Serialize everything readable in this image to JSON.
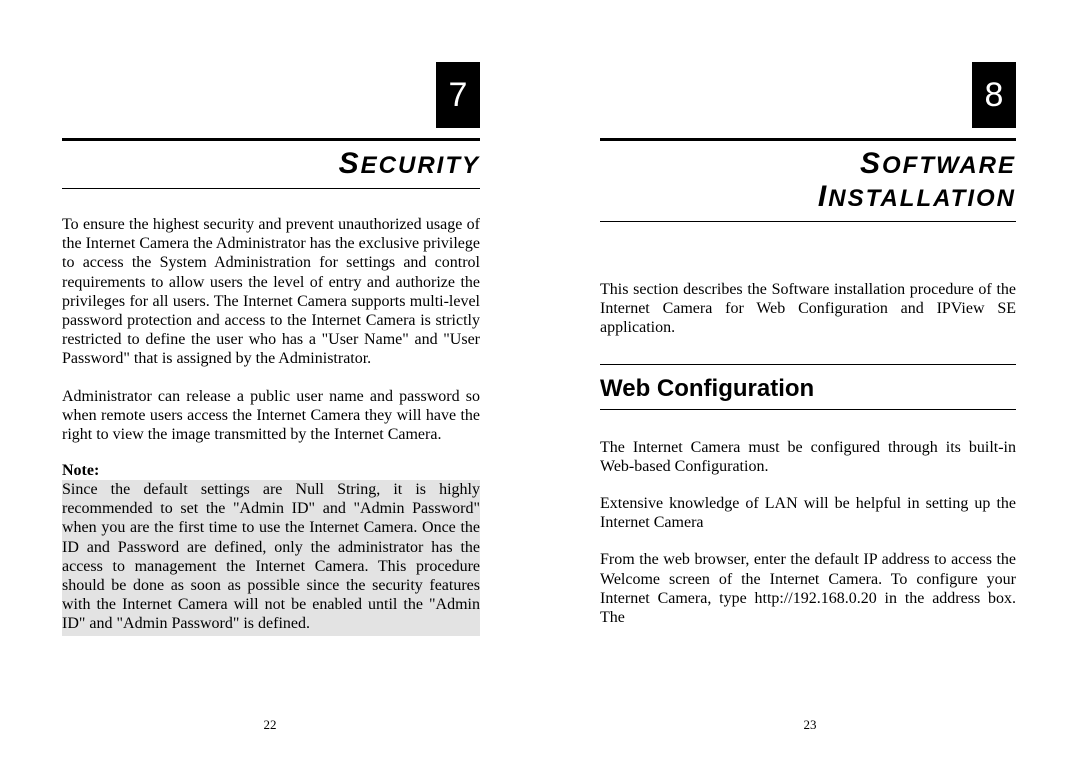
{
  "left": {
    "chapterNumber": "7",
    "title": "SECURITY",
    "paragraphs": [
      "To ensure the highest security and prevent unauthorized usage of the Internet Camera the Administrator has the exclusive privilege to access the System Administration for settings and control requirements to allow users the level of entry and authorize the privileges for all users.  The Internet Camera supports multi-level password protection and access to the Internet Camera is strictly restricted to define the user who has a \"User Name\" and \"User Password\" that is assigned by the Administrator.",
      "Administrator can release a public user name and password so when remote users access the Internet Camera they will have the right to view the image transmitted by the Internet Camera."
    ],
    "noteLabel": "Note:",
    "noteText": "Since the default settings are Null String, it is highly recommended to set the \"Admin ID\" and \"Admin Password\" when you are the first time to use the Internet Camera.  Once the ID and Password are defined, only the administrator has the access to management the Internet Camera.  This procedure should be done as soon as possible since the security features with the Internet Camera will not be enabled until the \"Admin ID\" and \"Admin Password\" is defined.",
    "pageNumber": "22"
  },
  "right": {
    "chapterNumber": "8",
    "titleLine1": "SOFTWARE",
    "titleLine2": "INSTALLATION",
    "intro": "This section describes the Software installation procedure of the Internet Camera for Web Configuration and IPView SE application.",
    "sectionHeading": "Web Configuration",
    "paragraphs": [
      "The Internet Camera must be configured through its built-in Web-based Configuration.",
      "Extensive knowledge of LAN will be helpful in setting up the Internet Camera",
      "From the web browser, enter the default IP address to access the Welcome screen of the Internet Camera.  To configure your Internet Camera, type http://192.168.0.20 in the address box.  The"
    ],
    "pageNumber": "23"
  }
}
